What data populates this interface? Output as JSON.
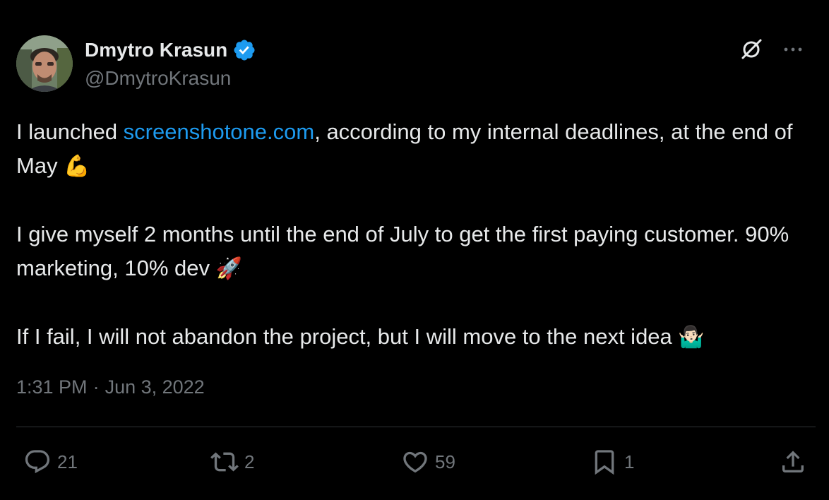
{
  "author": {
    "name": "Dmytro Krasun",
    "handle": "@DmytroKrasun",
    "verified": true
  },
  "tweet": {
    "para1_pre": "I launched ",
    "para1_link": "screenshotone.com",
    "para1_post": ", according to my internal deadlines, at the end of May ",
    "para1_emoji": "💪",
    "para2": "I give myself 2 months until the end of July to get the first paying customer. 90% marketing, 10% dev ",
    "para2_emoji": "🚀",
    "para3": "If I fail, I will not abandon the project, but I will move to the next idea ",
    "para3_emoji": "🤷🏻‍♂️"
  },
  "meta": {
    "time": "1:31 PM",
    "separator": "·",
    "date": "Jun 3, 2022"
  },
  "actions": {
    "replies": "21",
    "retweets": "2",
    "likes": "59",
    "bookmarks": "1"
  },
  "colors": {
    "background": "#000000",
    "text": "#e7e9ea",
    "muted": "#71767b",
    "link": "#1d9bf0",
    "verified": "#1d9bf0",
    "divider": "#2f3336"
  },
  "icons": {
    "grok": "grok-slash-icon",
    "more": "more-dots-icon",
    "reply": "reply-bubble-icon",
    "retweet": "retweet-icon",
    "like": "heart-icon",
    "bookmark": "bookmark-icon",
    "share": "share-icon"
  }
}
